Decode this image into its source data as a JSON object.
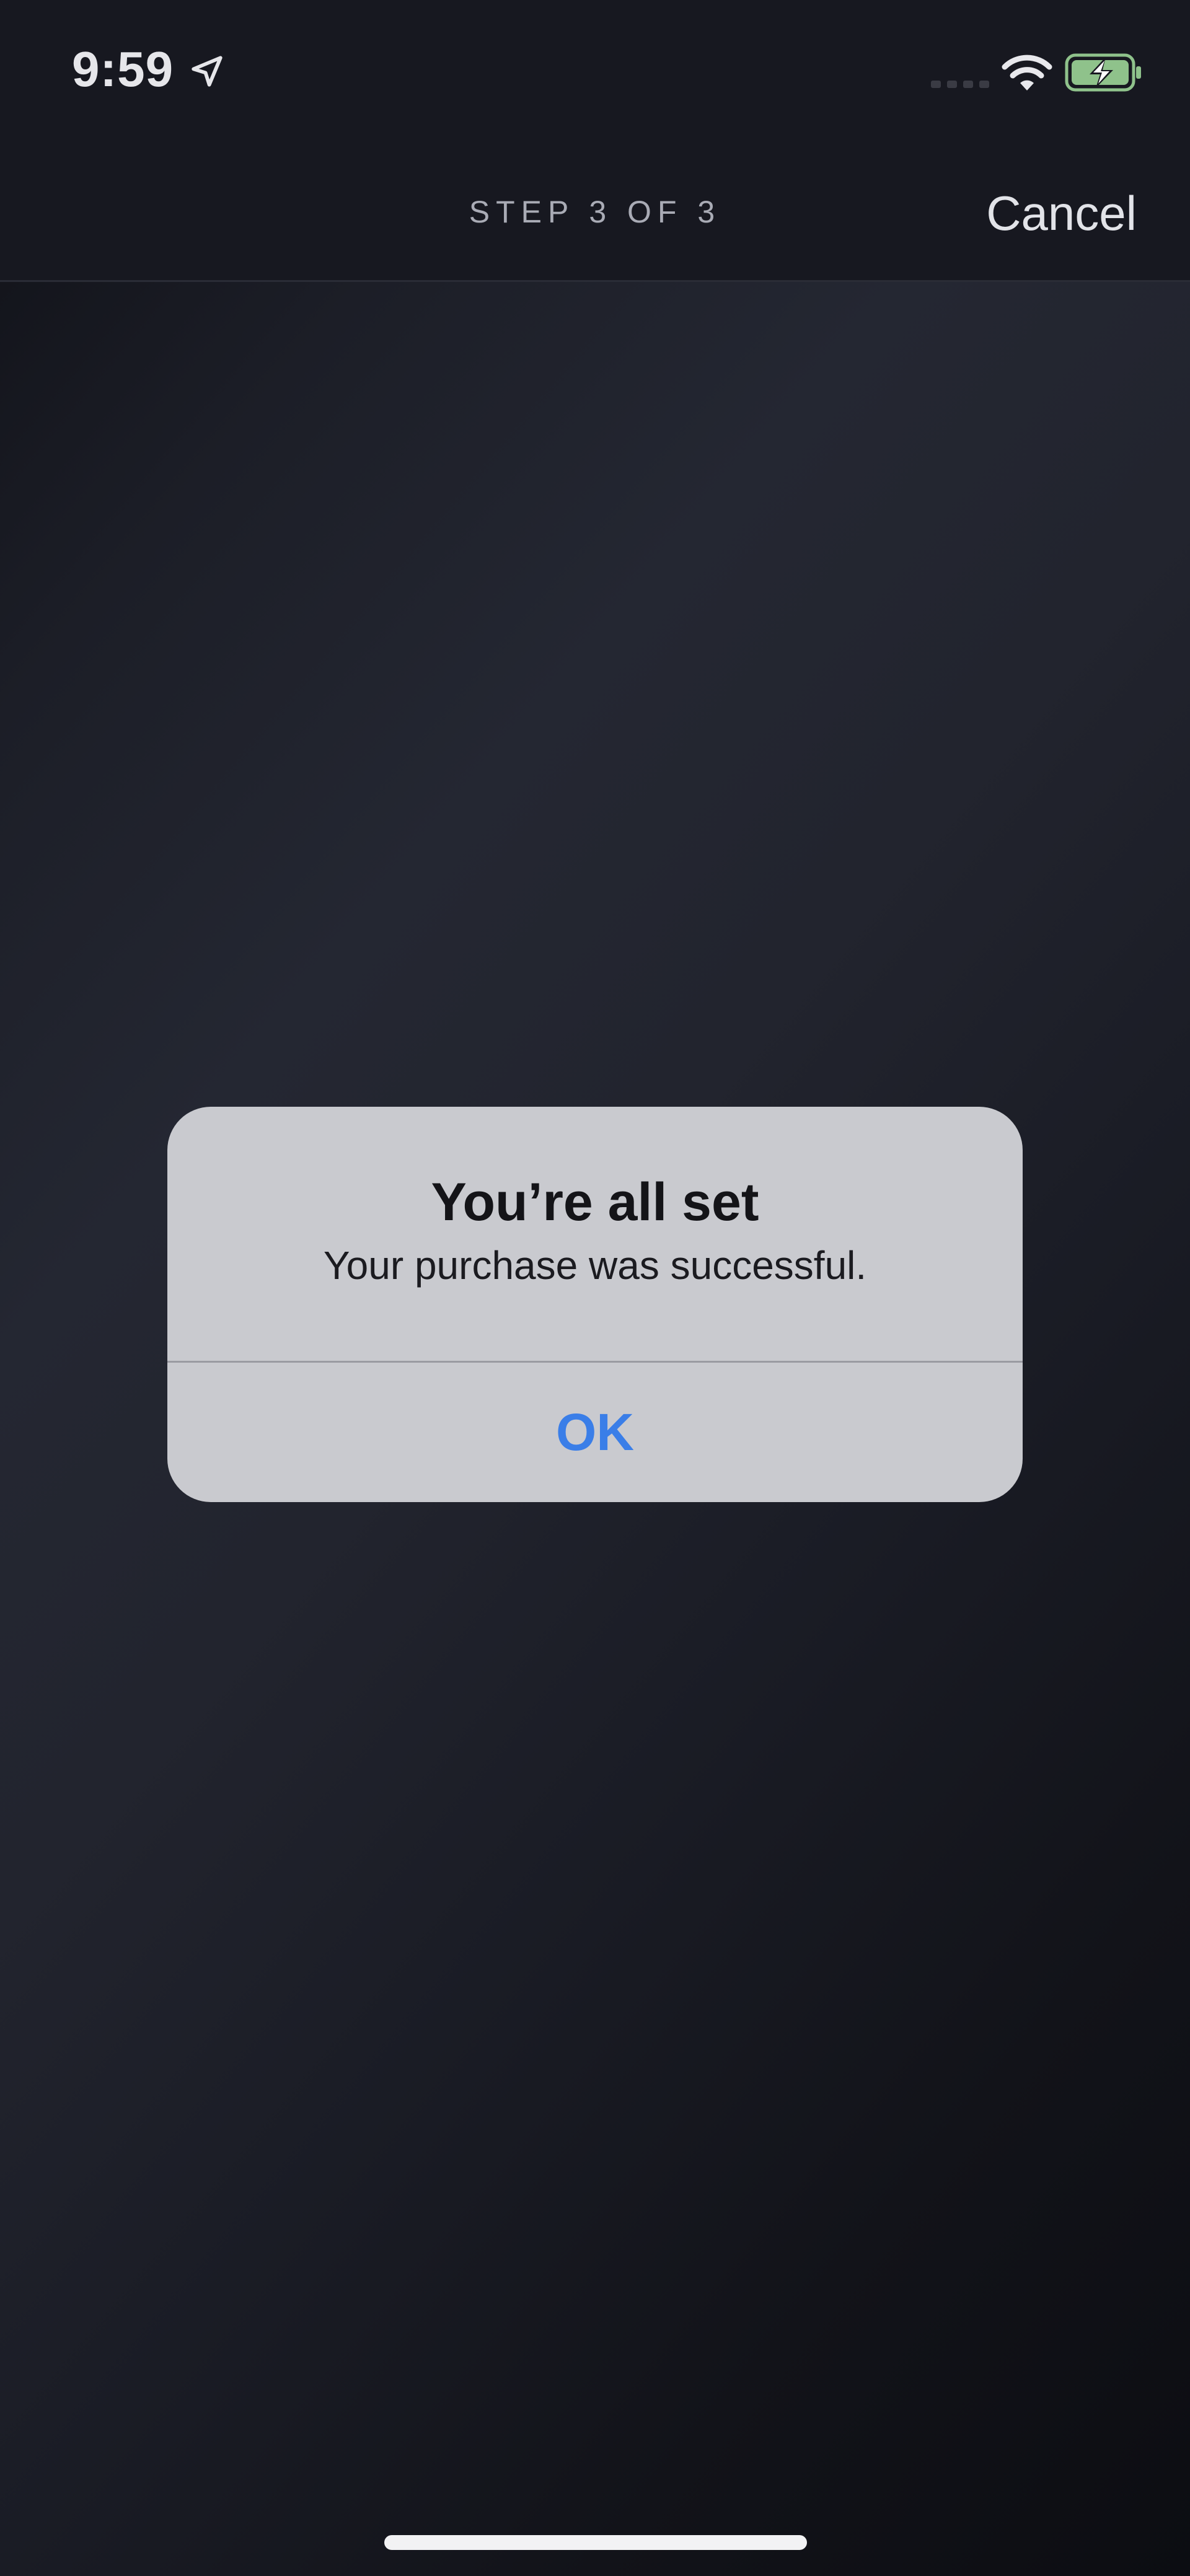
{
  "status_bar": {
    "time": "9:59",
    "location_icon": "location-arrow-icon",
    "signal_icon": "cellular-signal-icon",
    "wifi_icon": "wifi-icon",
    "battery_icon": "battery-charging-icon",
    "battery_color": "#8fc28b"
  },
  "nav": {
    "step_label": "STEP 3 OF 3",
    "cancel_label": "Cancel"
  },
  "alert": {
    "title": "You’re all set",
    "message": "Your purchase was successful.",
    "ok_label": "OK",
    "ok_color": "#3a7ee8"
  }
}
